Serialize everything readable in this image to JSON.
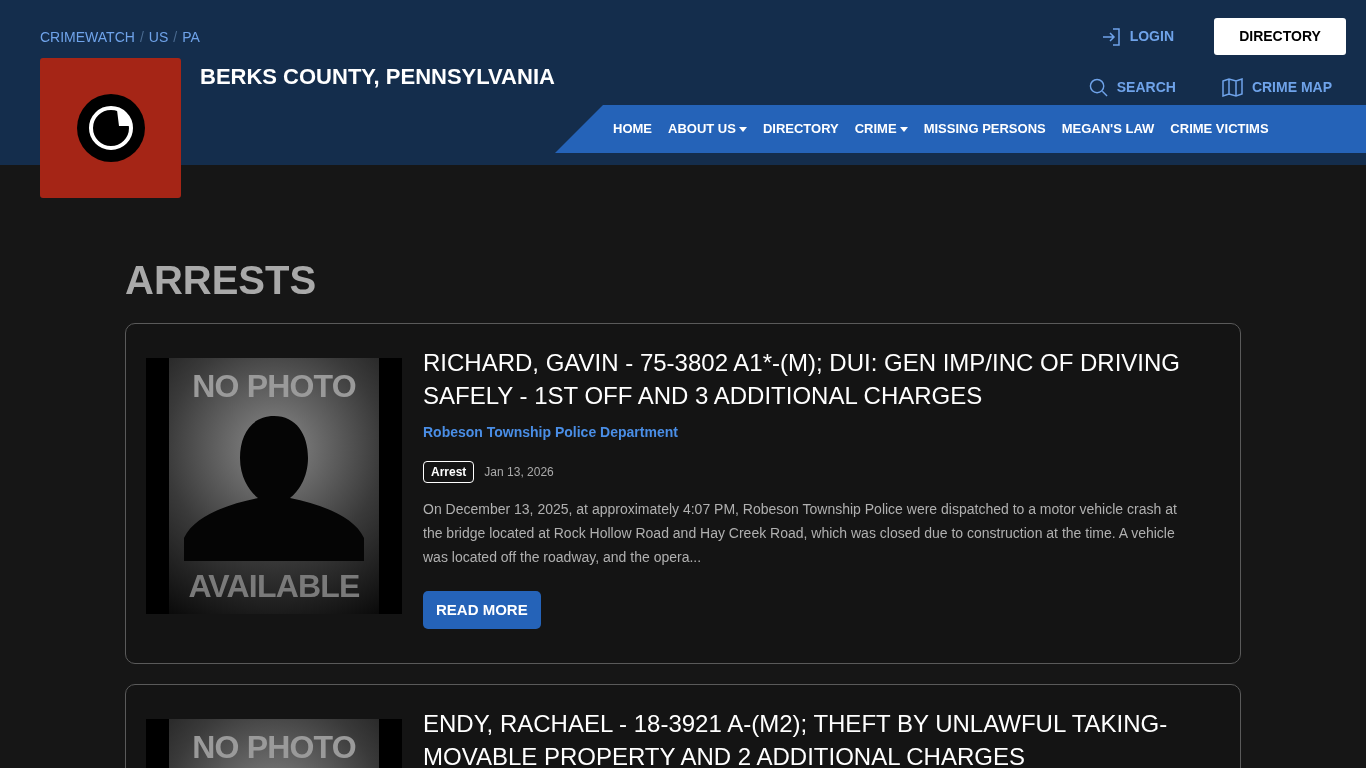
{
  "breadcrumb": {
    "items": [
      "CRIMEWATCH",
      "US",
      "PA"
    ],
    "separator": "/"
  },
  "site_title": "BERKS COUNTY, PENNSYLVANIA",
  "header_links": {
    "login": "LOGIN",
    "directory": "DIRECTORY",
    "search": "SEARCH",
    "crime_map": "CRIME MAP"
  },
  "nav": [
    {
      "label": "HOME",
      "dropdown": false
    },
    {
      "label": "ABOUT US",
      "dropdown": true
    },
    {
      "label": "DIRECTORY",
      "dropdown": false
    },
    {
      "label": "CRIME",
      "dropdown": true
    },
    {
      "label": "MISSING PERSONS",
      "dropdown": false
    },
    {
      "label": "MEGAN'S LAW",
      "dropdown": false
    },
    {
      "label": "CRIME VICTIMS",
      "dropdown": false
    }
  ],
  "page_title": "ARRESTS",
  "arrests": [
    {
      "photo_top": "NO PHOTO",
      "photo_bottom": "AVAILABLE",
      "title": "RICHARD, GAVIN - 75-3802 A1*-(M); DUI: GEN IMP/INC OF DRIVING SAFELY - 1ST OFF AND 3 ADDITIONAL CHARGES",
      "agency": "Robeson Township Police Department",
      "tag": "Arrest",
      "date": "Jan 13, 2026",
      "summary": "On December 13, 2025, at approximately 4:07 PM, Robeson Township Police were dispatched to a motor vehicle crash at the bridge located at Rock Hollow Road and Hay Creek Road, which was closed due to construction at the time. A vehicle was located off the roadway, and the opera...",
      "button": "READ MORE"
    },
    {
      "photo_top": "NO PHOTO",
      "title": "ENDY, RACHAEL - 18-3921 A-(M2); THEFT BY UNLAWFUL TAKING-MOVABLE PROPERTY AND 2 ADDITIONAL CHARGES"
    }
  ]
}
